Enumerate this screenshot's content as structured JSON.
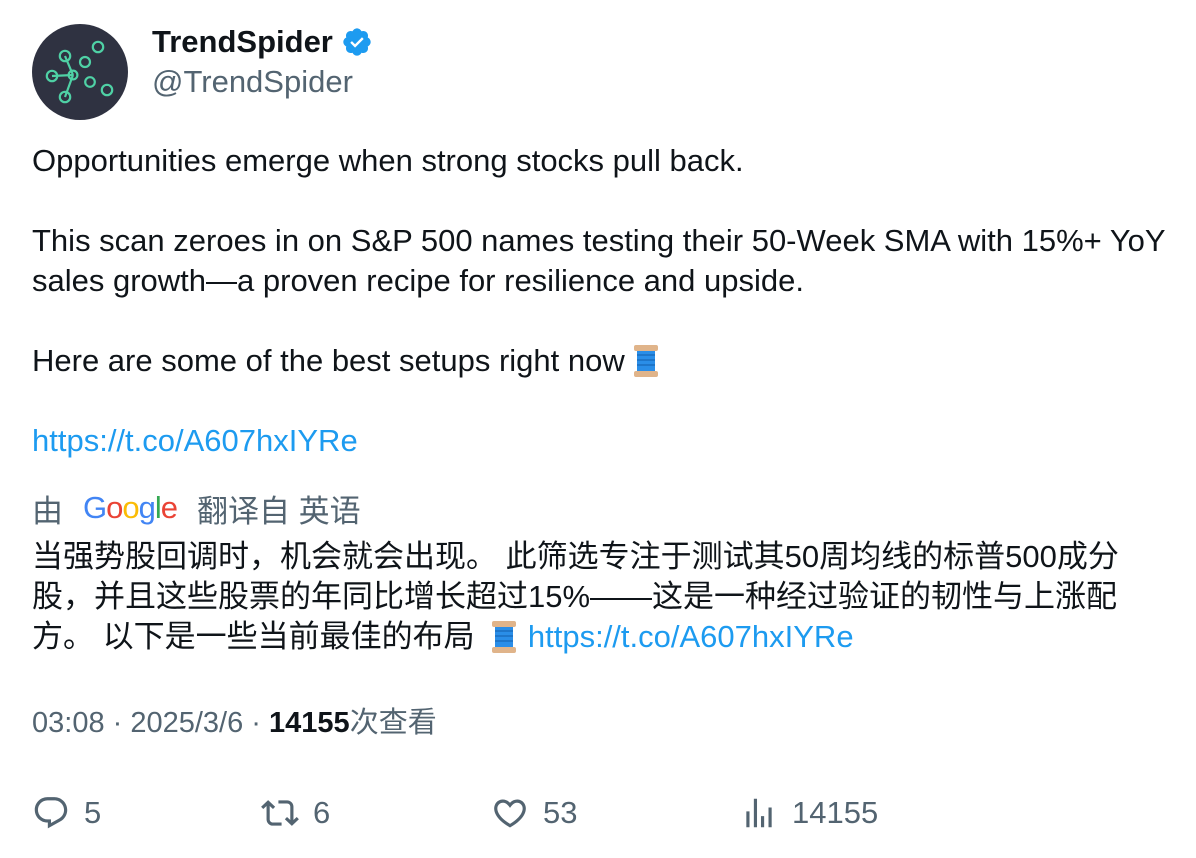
{
  "author": {
    "display_name": "TrendSpider",
    "handle": "@TrendSpider",
    "verified": true
  },
  "tweet": {
    "line1": "Opportunities emerge when strong stocks pull back.",
    "line2": "This scan zeroes in on S&P 500 names testing their 50-Week SMA with 15%+ YoY sales growth—a proven recipe for resilience and upside.",
    "line3": "Here are some of the best setups right now",
    "link": "https://t.co/A607hxIYRe"
  },
  "translation": {
    "prefix": "由",
    "provider": "Google",
    "suffix": "翻译自 英语",
    "text": "当强势股回调时，机会就会出现。 此筛选专注于测试其50周均线的标普500成分股，并且这些股票的年同比增长超过15%——这是一种经过验证的韧性与上涨配方。 以下是一些当前最佳的布局",
    "link": "https://t.co/A607hxIYRe"
  },
  "meta": {
    "time": "03:08",
    "separator": " · ",
    "date": "2025/3/6",
    "views_count": "14155",
    "views_label": "次查看"
  },
  "actions": {
    "replies": "5",
    "retweets": "6",
    "likes": "53",
    "views": "14155"
  },
  "colors": {
    "accent": "#1d9bf0",
    "muted": "#536471",
    "text": "#0f1419",
    "avatar_bg": "#2f3241",
    "avatar_dots": "#4fd1a5"
  },
  "icons": {
    "reply": "reply-icon",
    "retweet": "retweet-icon",
    "like": "heart-icon",
    "views": "analytics-icon",
    "verified": "verified-badge-icon",
    "thread": "spool-emoji-icon"
  }
}
